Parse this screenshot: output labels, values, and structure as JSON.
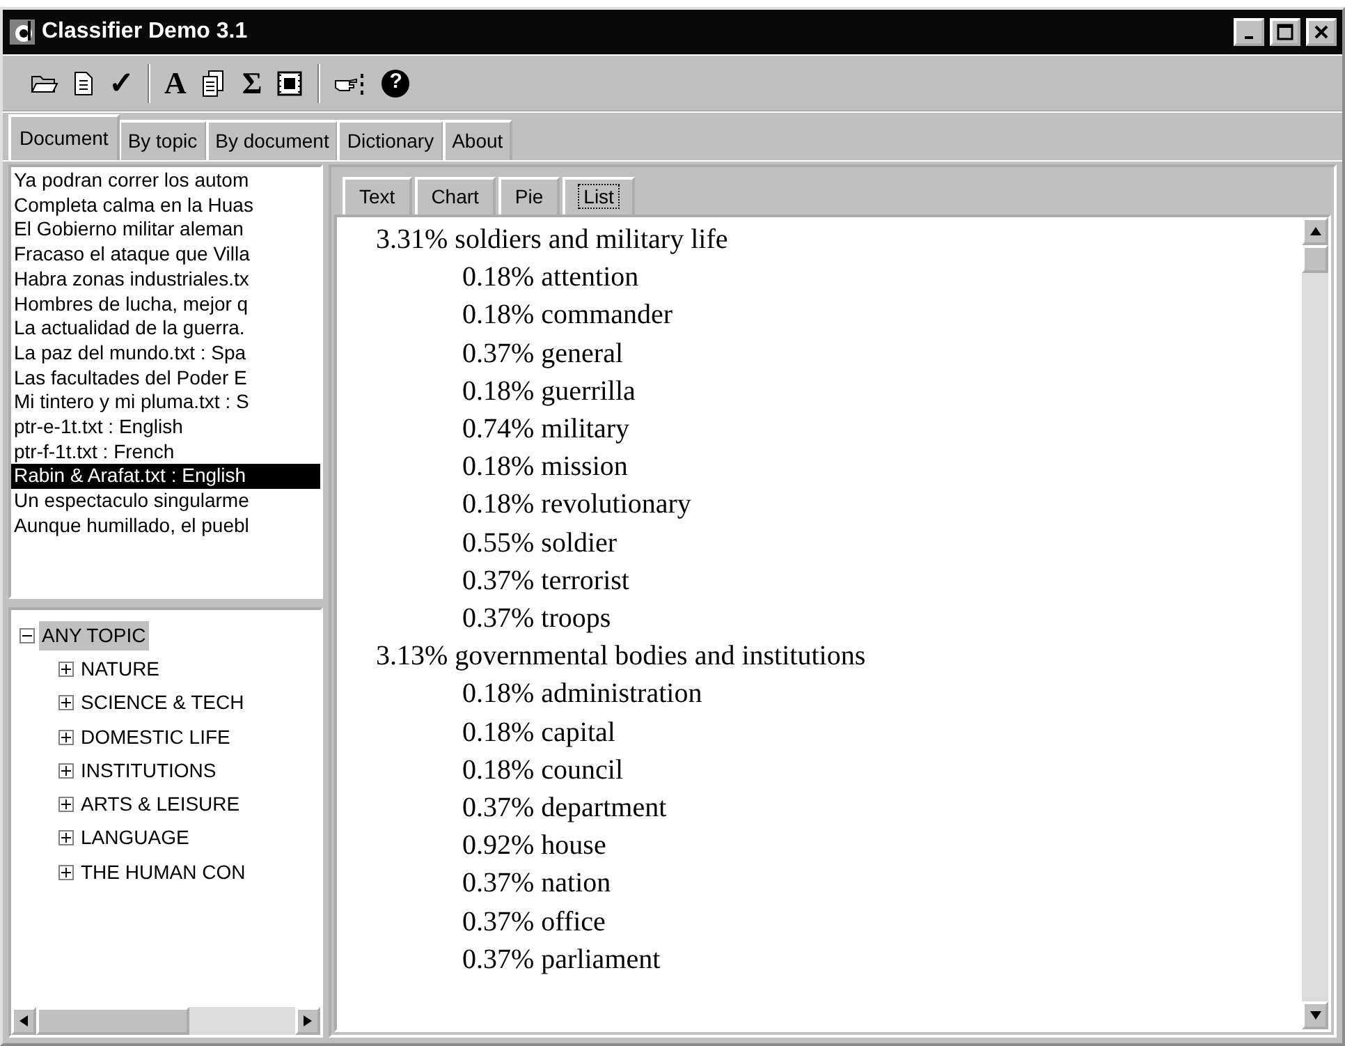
{
  "window": {
    "title": "Classifier Demo 3.1"
  },
  "toolbar": [
    {
      "kind": "folder"
    },
    {
      "kind": "page"
    },
    {
      "kind": "glyph",
      "text": "✓"
    },
    {
      "kind": "separator"
    },
    {
      "kind": "letter",
      "text": "A"
    },
    {
      "kind": "pages"
    },
    {
      "kind": "glyph",
      "text": "Σ"
    },
    {
      "kind": "film"
    },
    {
      "kind": "separator"
    },
    {
      "kind": "hand"
    },
    {
      "kind": "help",
      "text": "?"
    }
  ],
  "tabs": [
    {
      "label": "Document",
      "selected": true
    },
    {
      "label": "By topic",
      "selected": false
    },
    {
      "label": "By document",
      "selected": false
    },
    {
      "label": "Dictionary",
      "selected": false
    },
    {
      "label": "About",
      "selected": false
    }
  ],
  "documents": [
    {
      "text": "Ya podran correr los autom",
      "selected": false
    },
    {
      "text": "Completa calma en la Huas",
      "selected": false
    },
    {
      "text": "El Gobierno militar aleman",
      "selected": false
    },
    {
      "text": "Fracaso el ataque que Villa",
      "selected": false
    },
    {
      "text": "Habra zonas industriales.tx",
      "selected": false
    },
    {
      "text": "Hombres de lucha, mejor q",
      "selected": false
    },
    {
      "text": "La actualidad de la guerra.",
      "selected": false
    },
    {
      "text": "La paz del mundo.txt : Spa",
      "selected": false
    },
    {
      "text": "Las facultades del Poder E",
      "selected": false
    },
    {
      "text": "Mi tintero y mi pluma.txt : S",
      "selected": false
    },
    {
      "text": "ptr-e-1t.txt : English",
      "selected": false
    },
    {
      "text": "ptr-f-1t.txt : French",
      "selected": false
    },
    {
      "text": "Rabin & Arafat.txt : English",
      "selected": true
    },
    {
      "text": "Un espectaculo singularme",
      "selected": false
    },
    {
      "text": "Aunque humillado, el puebl",
      "selected": false
    }
  ],
  "topic_tree": [
    {
      "label": "ANY TOPIC",
      "expanded": true,
      "selected": true,
      "children": [
        {
          "label": "NATURE",
          "expanded": false,
          "selected": false
        },
        {
          "label": "SCIENCE & TECH",
          "expanded": false,
          "selected": false
        },
        {
          "label": "DOMESTIC LIFE",
          "expanded": false,
          "selected": false
        },
        {
          "label": "INSTITUTIONS",
          "expanded": false,
          "selected": false
        },
        {
          "label": "ARTS & LEISURE",
          "expanded": false,
          "selected": false
        },
        {
          "label": "LANGUAGE",
          "expanded": false,
          "selected": false
        },
        {
          "label": "THE HUMAN CON",
          "expanded": false,
          "selected": false
        }
      ]
    }
  ],
  "view_tabs": [
    {
      "label": "Text",
      "selected": false
    },
    {
      "label": "Chart",
      "selected": false
    },
    {
      "label": "Pie",
      "selected": false
    },
    {
      "label": "List",
      "selected": true
    }
  ],
  "topic_list": [
    {
      "text": "3.31% soldiers and military life",
      "children": [
        {
          "text": "0.18% attention"
        },
        {
          "text": "0.18% commander"
        },
        {
          "text": "0.37% general"
        },
        {
          "text": "0.18% guerrilla"
        },
        {
          "text": "0.74% military"
        },
        {
          "text": "0.18% mission"
        },
        {
          "text": "0.18% revolutionary"
        },
        {
          "text": "0.55% soldier"
        },
        {
          "text": "0.37% terrorist"
        },
        {
          "text": "0.37% troops"
        }
      ]
    },
    {
      "text": "3.13% governmental bodies and institutions",
      "children": [
        {
          "text": "0.18% administration"
        },
        {
          "text": "0.18% capital"
        },
        {
          "text": "0.18% council"
        },
        {
          "text": "0.37% department"
        },
        {
          "text": "0.92% house"
        },
        {
          "text": "0.37% nation"
        },
        {
          "text": "0.37% office"
        },
        {
          "text": "0.37% parliament"
        }
      ]
    }
  ]
}
